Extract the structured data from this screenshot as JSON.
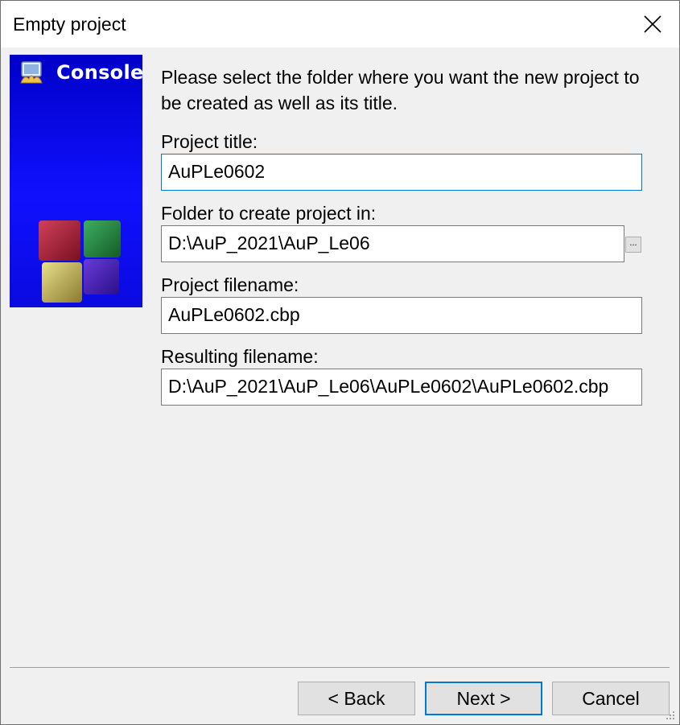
{
  "window": {
    "title": "Empty project"
  },
  "banner": {
    "label": "Console",
    "app_icon": "codeblocks-app-icon",
    "art_icon": "cubes-logo-icon"
  },
  "intro_text": "Please select the folder where you want the new project to be created as well as its title.",
  "fields": {
    "project_title": {
      "label": "Project title:",
      "value": "AuPLe0602"
    },
    "folder": {
      "label": "Folder to create project in:",
      "value": "D:\\AuP_2021\\AuP_Le06",
      "browse_label": "..."
    },
    "project_filename": {
      "label": "Project filename:",
      "value": "AuPLe0602.cbp"
    },
    "resulting_filename": {
      "label": "Resulting filename:",
      "value": "D:\\AuP_2021\\AuP_Le06\\AuPLe0602\\AuPLe0602.cbp"
    }
  },
  "buttons": {
    "back": "< Back",
    "next": "Next >",
    "cancel": "Cancel"
  },
  "colors": {
    "banner_blue": "#1010ff",
    "focus_blue": "#0078d7"
  }
}
